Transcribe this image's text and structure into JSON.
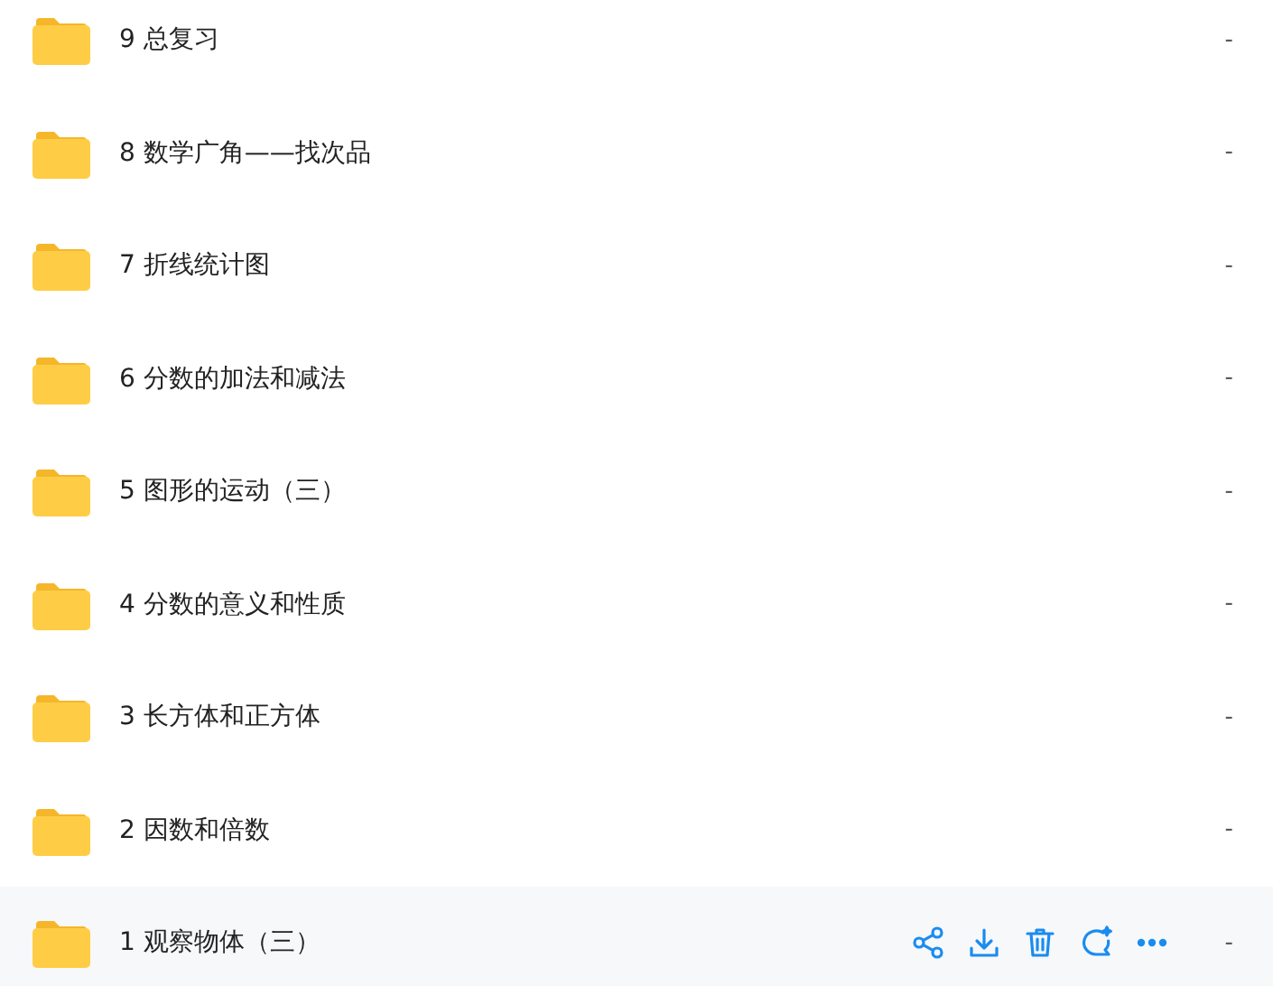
{
  "files": [
    {
      "name": "9 总复习",
      "size": "-",
      "hovered": false
    },
    {
      "name": "8 数学广角——找次品",
      "size": "-",
      "hovered": false
    },
    {
      "name": "7 折线统计图",
      "size": "-",
      "hovered": false
    },
    {
      "name": "6 分数的加法和减法",
      "size": "-",
      "hovered": false
    },
    {
      "name": "5 图形的运动（三）",
      "size": "-",
      "hovered": false
    },
    {
      "name": "4 分数的意义和性质",
      "size": "-",
      "hovered": false
    },
    {
      "name": "3 长方体和正方体",
      "size": "-",
      "hovered": false
    },
    {
      "name": "2 因数和倍数",
      "size": "-",
      "hovered": false
    },
    {
      "name": "1 观察物体（三）",
      "size": "-",
      "hovered": true
    }
  ]
}
